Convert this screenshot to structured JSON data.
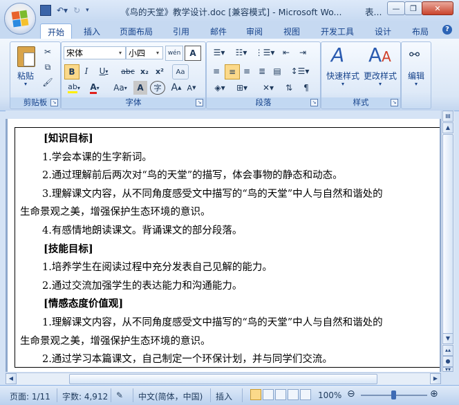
{
  "window": {
    "title": "《鸟的天堂》教学设计.doc [兼容模式] - Microsoft Wo...",
    "title_right": "表..."
  },
  "tabs": [
    {
      "label": "开始",
      "active": true
    },
    {
      "label": "插入"
    },
    {
      "label": "页面布局"
    },
    {
      "label": "引用"
    },
    {
      "label": "邮件"
    },
    {
      "label": "审阅"
    },
    {
      "label": "视图"
    },
    {
      "label": "开发工具"
    },
    {
      "label": "设计"
    },
    {
      "label": "布局"
    }
  ],
  "ribbon": {
    "clipboard": {
      "label": "剪贴板",
      "paste": "粘贴"
    },
    "font": {
      "label": "字体",
      "font_name": "宋体",
      "font_size": "小四",
      "wen_button": "wén",
      "char_border": "A",
      "bold": "B",
      "italic": "I",
      "underline": "U",
      "strike": "abc",
      "subscript": "x₂",
      "superscript": "x²",
      "clear": "Aa",
      "font_color": "A",
      "change_case": "Aa",
      "char_shade": "A",
      "enclose": "字",
      "grow": "A",
      "shrink": "A"
    },
    "paragraph": {
      "label": "段落"
    },
    "styles": {
      "label": "样式",
      "quick": "快速样式",
      "change": "更改样式"
    },
    "editing": {
      "label": "编辑"
    }
  },
  "document": {
    "lines": [
      {
        "text": "[知识目标]",
        "heading": true
      },
      {
        "text": "1.学会本课的生字新词。"
      },
      {
        "text": "2.通过理解前后两次对“鸟的天堂”的描写，体会事物的静态和动态。"
      },
      {
        "text": "3.理解课文内容，从不同角度感受文中描写的“鸟的天堂”中人与自然和谐处的"
      },
      {
        "text": "生命景观之美，增强保护生态环境的意识。",
        "flush": true
      },
      {
        "text": "4.有感情地朗读课文。背诵课文的部分段落。"
      },
      {
        "text": "[技能目标]",
        "heading": true
      },
      {
        "text": "1.培养学生在阅读过程中充分发表自己见解的能力。"
      },
      {
        "text": "2.通过交流加强学生的表达能力和沟通能力。"
      },
      {
        "text": "[情感态度价值观]",
        "heading": true
      },
      {
        "text": "1.理解课文内容，从不同角度感受文中描写的“鸟的天堂”中人与自然和谐处的"
      },
      {
        "text": "生命景观之美，增强保护生态环境的意识。",
        "flush": true
      },
      {
        "text": "2.通过学习本篇课文，自己制定一个环保计划，并与同学们交流。"
      }
    ]
  },
  "status": {
    "page": "页面: 1/11",
    "words": "字数: 4,912",
    "language": "中文(简体，中国)",
    "mode": "插入",
    "zoom": "100%"
  }
}
